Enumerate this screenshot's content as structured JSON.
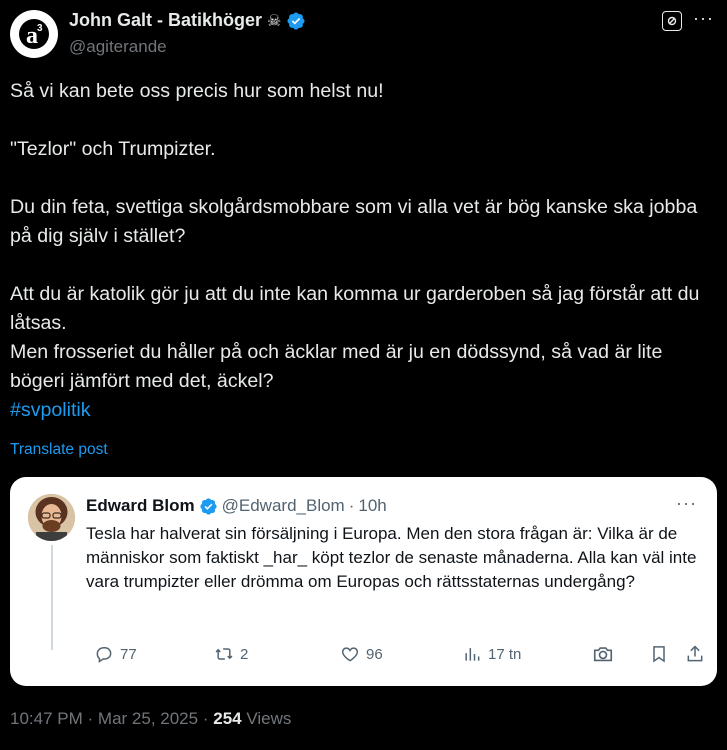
{
  "author": {
    "display_name": "John Galt - Batikhöger",
    "name_emoji": "☠",
    "handle": "@agiterande",
    "avatar_letters": "a"
  },
  "tweet": {
    "paragraphs": [
      "Så vi kan bete oss precis hur som helst nu!",
      "\"Tezlor\" och Trumpizter.",
      "Du din feta, svettiga skolgårdsmobbare som vi alla vet är bög kanske ska jobba på dig själv i stället?",
      "Att du är katolik gör ju att du inte kan komma ur garderoben så jag förstår att du låtsas.",
      " Men frosseriet du håller på och äcklar med är ju en dödssynd, så vad är lite bögeri jämfört med det, äckel?"
    ],
    "hashtag": "#svpolitik",
    "translate_label": "Translate post"
  },
  "quoted": {
    "name": "Edward Blom",
    "handle": "@Edward_Blom",
    "separator": "·",
    "time": "10h",
    "text": "Tesla har halverat sin försäljning  i Europa. Men den stora frågan är: Vilka är de människor som faktiskt _har_ köpt tezlor de senaste månaderna. Alla kan väl inte vara trumpizter eller drömma om Europas och rättsstaternas undergång?",
    "replies": "77",
    "reposts": "2",
    "likes": "96",
    "views": "17 tn"
  },
  "footer": {
    "time": "10:47 PM",
    "separator": "·",
    "date": "Mar 25, 2025",
    "separator2": "·",
    "views_count": "254",
    "views_label": "Views"
  },
  "colors": {
    "background": "#000000",
    "accent": "#1d9bf0",
    "muted": "#71767b"
  }
}
